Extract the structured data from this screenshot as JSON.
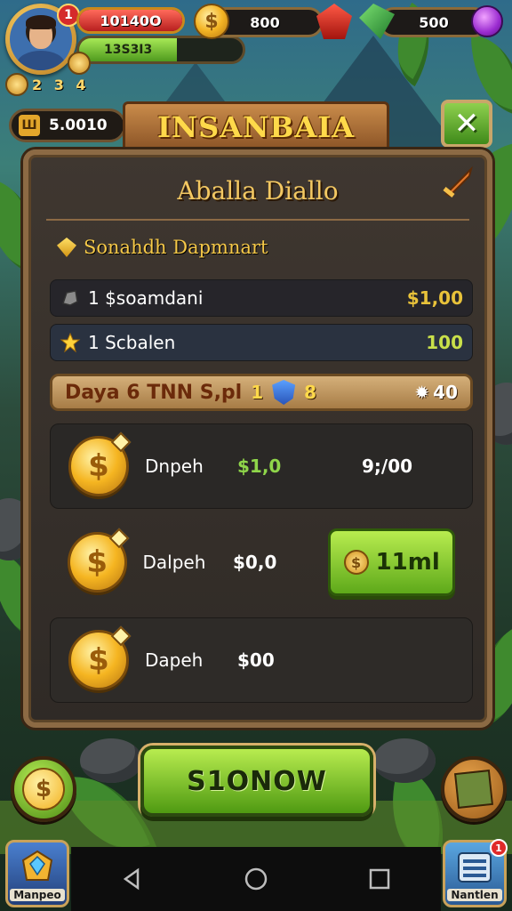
{
  "hud": {
    "health_value": "10140O",
    "xp_value": "13S3I3",
    "level_text": "2 3 4",
    "notification_badge": "1",
    "coins_value": "800",
    "gems_value": "500",
    "gold_value": "5.0010",
    "gold_icon_text": "Ш"
  },
  "header": {
    "banner_title": "INSANBAIA"
  },
  "panel": {
    "title": "Aballa Diallo",
    "section_title": "Sonahdh Dapmnart",
    "rows": [
      {
        "label": "1 $soamdani",
        "value": "$1,00"
      },
      {
        "label": "1 Scbalen",
        "value": "100"
      }
    ],
    "promo": {
      "text": "Daya 6 TNN S,pl",
      "num1": "1",
      "num2": "8",
      "right_value": "40"
    },
    "offers": [
      {
        "name": "Dnpeh",
        "price": "$1,0",
        "amount": "9;/00"
      },
      {
        "name": "Dalpeh",
        "price": "$0,0",
        "button_label": "11ml"
      },
      {
        "name": "Dapeh",
        "price": "$00"
      }
    ]
  },
  "bottom": {
    "main_button_label": "S1ONOW",
    "left_corner_label": "Manpeo",
    "right_corner_label": "Nantlen",
    "right_corner_badge": "1"
  },
  "colors": {
    "accent_gold": "#f3c862",
    "button_green": "#8ed04e",
    "panel_border": "#8c6a44"
  }
}
